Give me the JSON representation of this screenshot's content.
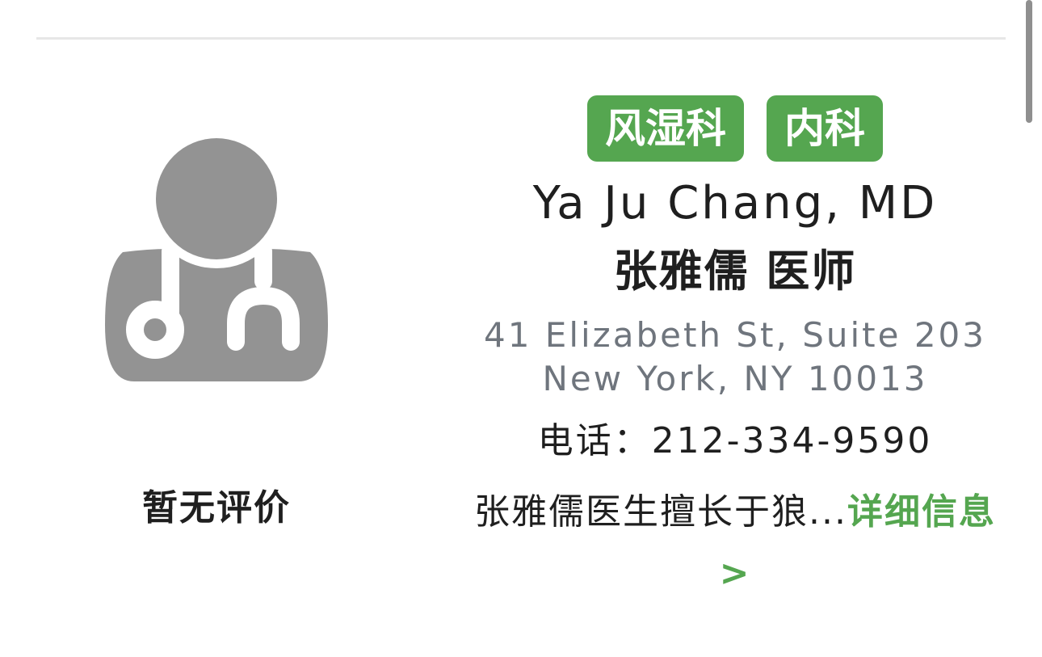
{
  "doctor": {
    "specialties": [
      "风湿科",
      "内科"
    ],
    "name_en": "Ya Ju Chang, MD",
    "name_zh": "张雅儒 医师",
    "address_line1": "41 Elizabeth St, Suite 203",
    "address_line2": "New York, NY 10013",
    "phone": "电话：212-334-9590",
    "bio_excerpt": "张雅儒医生擅长于狼...",
    "details_link": "详细信息 >",
    "rating_text": "暂无评价",
    "avatar_icon": "doctor-avatar-icon"
  },
  "colors": {
    "accent_green": "#55a650",
    "avatar_gray": "#939393",
    "address_gray": "#6f757d",
    "divider": "#e7e7e7"
  }
}
